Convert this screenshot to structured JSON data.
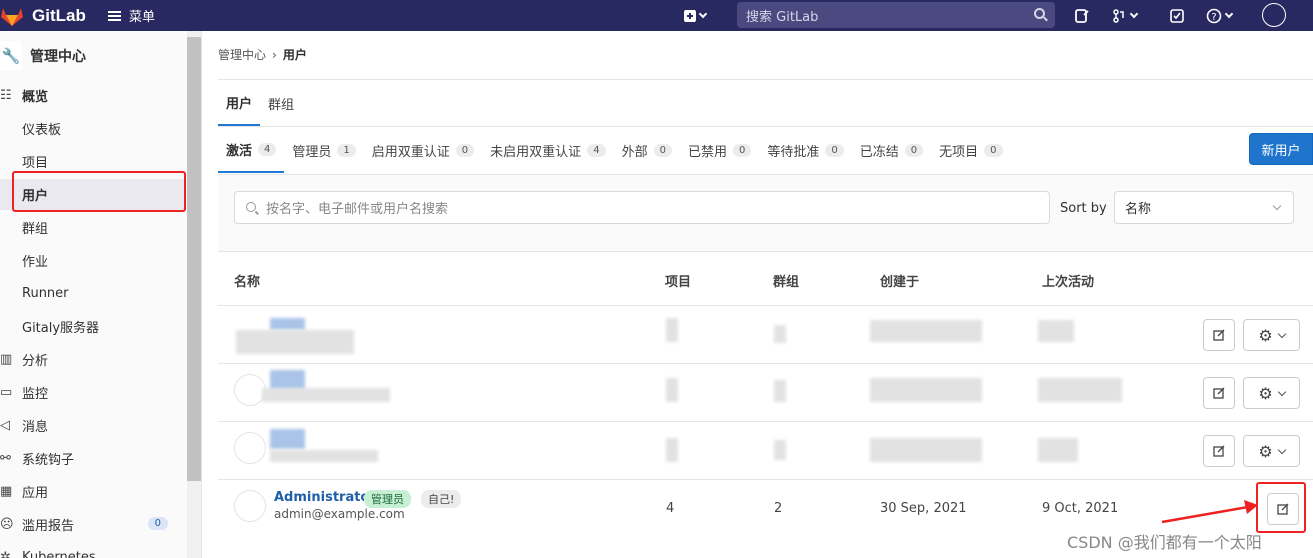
{
  "navbar": {
    "brand": "GitLab",
    "menu_label": "菜单",
    "search_placeholder": "搜索 GitLab"
  },
  "sidebar": {
    "header": "管理中心",
    "items": [
      {
        "label": "概览",
        "icon": "overview-icon"
      },
      {
        "label": "仪表板"
      },
      {
        "label": "项目"
      },
      {
        "label": "用户"
      },
      {
        "label": "群组"
      },
      {
        "label": "作业"
      },
      {
        "label": "Runner"
      },
      {
        "label": "Gitaly服务器"
      },
      {
        "label": "分析",
        "icon": "chart-icon"
      },
      {
        "label": "监控",
        "icon": "monitor-icon"
      },
      {
        "label": "消息",
        "icon": "megaphone-icon"
      },
      {
        "label": "系统钩子",
        "icon": "hook-icon"
      },
      {
        "label": "应用",
        "icon": "apps-icon"
      },
      {
        "label": "滥用报告",
        "icon": "abuse-icon",
        "badge": "0"
      },
      {
        "label": "Kubernetes",
        "icon": "kubernetes-icon"
      }
    ]
  },
  "breadcrumb": {
    "parent": "管理中心",
    "separator": "›",
    "current": "用户"
  },
  "top_tabs": [
    "用户",
    "群组"
  ],
  "filter_tabs": [
    {
      "label": "激活",
      "count": "4"
    },
    {
      "label": "管理员",
      "count": "1"
    },
    {
      "label": "启用双重认证",
      "count": "0"
    },
    {
      "label": "未启用双重认证",
      "count": "4"
    },
    {
      "label": "外部",
      "count": "0"
    },
    {
      "label": "已禁用",
      "count": "0"
    },
    {
      "label": "等待批准",
      "count": "0"
    },
    {
      "label": "已冻结",
      "count": "0"
    },
    {
      "label": "无项目",
      "count": "0"
    }
  ],
  "new_user_button": "新用户",
  "search": {
    "placeholder": "按名字、电子邮件或用户名搜索"
  },
  "sort": {
    "label": "Sort by",
    "value": "名称"
  },
  "table": {
    "headers": [
      "名称",
      "项目",
      "群组",
      "创建于",
      "上次活动"
    ],
    "admin_row": {
      "name": "Administrator",
      "badge_admin": "管理员",
      "badge_self": "自己!",
      "email": "admin@example.com",
      "projects": "4",
      "groups": "2",
      "created": "30 Sep, 2021",
      "last_activity": "9 Oct, 2021"
    }
  },
  "watermark": "CSDN @我们都有一个太阳",
  "colors": {
    "navbar": "#292961",
    "primary": "#1f75cb",
    "highlight": "#e22222"
  }
}
